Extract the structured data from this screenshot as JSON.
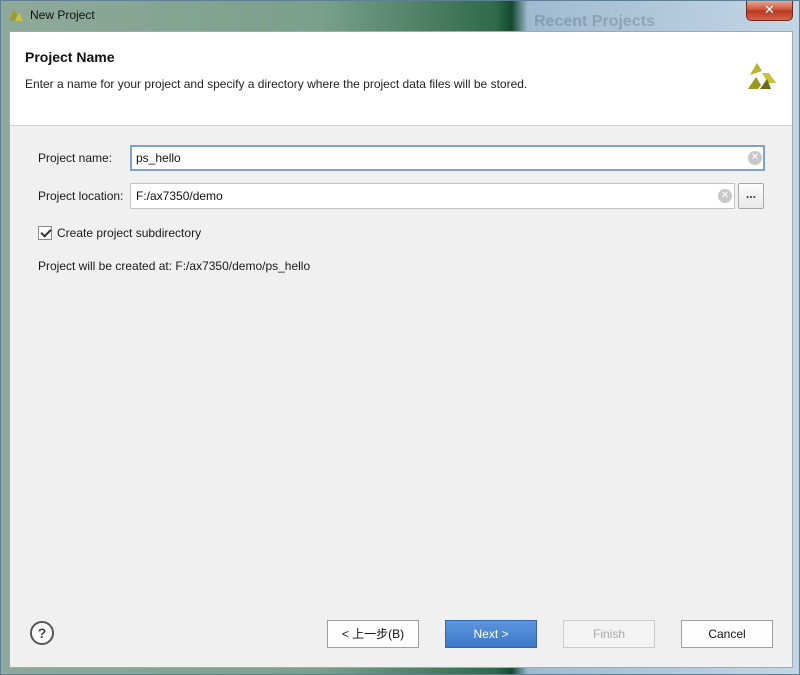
{
  "window": {
    "title": "New Project",
    "background_ghost_text": "Recent Projects",
    "close_glyph": "✕"
  },
  "header": {
    "title": "Project Name",
    "description": "Enter a name for your project and specify a directory where the project data files will be stored.",
    "logo_icon": "vivado-logo-icon"
  },
  "form": {
    "project_name_label": "Project name:",
    "project_name_value": "ps_hello",
    "project_location_label": "Project location:",
    "project_location_value": "F:/ax7350/demo",
    "browse_label": "...",
    "clear_glyph": "✕",
    "create_subdirectory_label": "Create project subdirectory",
    "create_subdirectory_checked": true,
    "created_at_text": "Project will be created at: F:/ax7350/demo/ps_hello"
  },
  "footer": {
    "help_label": "?",
    "back_label": "< 上一步(B)",
    "next_label": "Next >",
    "finish_label": "Finish",
    "cancel_label": "Cancel"
  },
  "colors": {
    "accent": "#4a82d0",
    "logo_yellow": "#b6b22a",
    "logo_dark": "#6e6b16"
  }
}
